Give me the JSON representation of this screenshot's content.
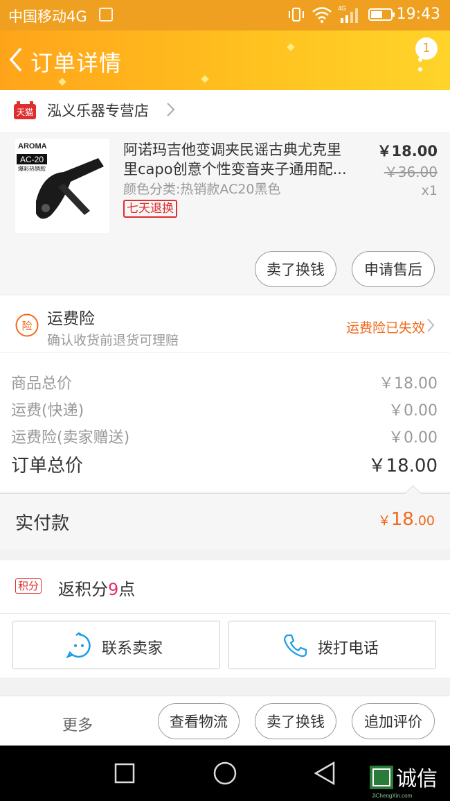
{
  "status_bar": {
    "carrier": "中国移动4G",
    "time": "19:43",
    "network": "4G"
  },
  "header": {
    "title": "订单详情",
    "badge_count": "1"
  },
  "store": {
    "platform_badge": "天猫",
    "name": "泓义乐器专营店"
  },
  "product": {
    "image_brand": "AROMA",
    "image_model": "AC-20",
    "image_tagline": "爆彩热销款",
    "title_line1": "阿诺玛吉他变调夹民谣古典尤克里",
    "title_line2": "里capo创意个性变音夹子通用配...",
    "variant": "颜色分类:热销款AC20黑色",
    "return_tag": "七天退换",
    "price": "￥18.00",
    "original_price": "￥36.00",
    "quantity": "x1",
    "buttons": [
      "卖了换钱",
      "申请售后"
    ]
  },
  "insurance": {
    "title": "运费险",
    "subtitle": "确认收货前退货可理赔",
    "status": "运费险已失效",
    "icon_char": "险"
  },
  "totals": {
    "rows": [
      {
        "label": "商品总价",
        "value": "￥18.00"
      },
      {
        "label": "运费(快递)",
        "value": "￥0.00"
      },
      {
        "label": "运费险(卖家赠送)",
        "value": "￥0.00"
      }
    ],
    "order_total_label": "订单总价",
    "order_total_value": "￥18.00"
  },
  "paid": {
    "label": "实付款",
    "currency": "￥",
    "amount_int": "18",
    "amount_dec": ".00"
  },
  "points": {
    "tag": "积分",
    "prefix": "返积分",
    "count": "9",
    "suffix": "点"
  },
  "actions": {
    "contact_seller": "联系卖家",
    "call": "拨打电话"
  },
  "bottom_bar": {
    "more": "更多",
    "buttons": [
      "查看物流",
      "卖了换钱",
      "追加评价"
    ]
  },
  "watermark": {
    "text": "诚信",
    "url": "JiChengXin.com"
  },
  "colors": {
    "header": "#ffb41c",
    "accent_orange": "#f0691a",
    "tmall_red": "#e02d2d"
  }
}
